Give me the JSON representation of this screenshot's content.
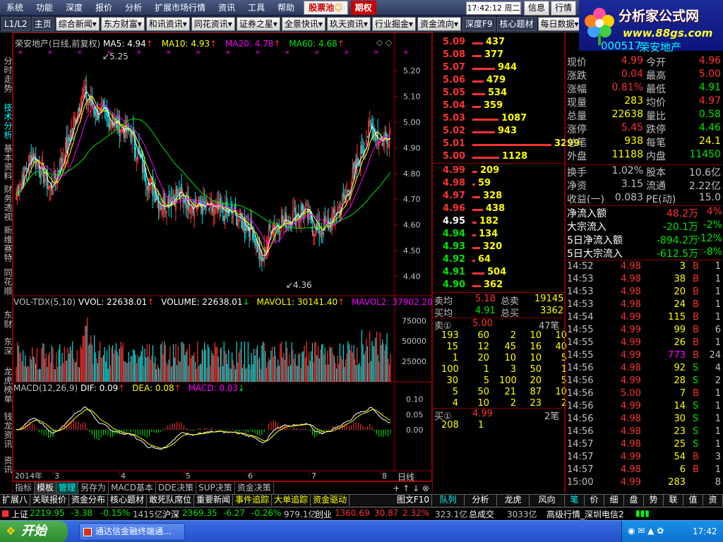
{
  "menu": {
    "items": [
      "系统",
      "功能",
      "深度",
      "报价",
      "分析",
      "扩展市场行情",
      "资讯",
      "工具",
      "帮助"
    ],
    "stock_pool": "股票池",
    "options": "期权",
    "clock": "17:42:12 周二",
    "msg": "信息",
    "quote": "行情"
  },
  "toolbar": {
    "items": [
      "L1/L2",
      "主页",
      "综合新闻▾",
      "东方财富▾",
      "和讯资讯▾",
      "同花资讯▾",
      "证券之星▾",
      "全景快讯▾",
      "玖天资讯▾",
      "行业掘金▾",
      "资金流向▾",
      "深度F9",
      "核心题材",
      "每日数据▾"
    ]
  },
  "logo": {
    "title": "分析家公式网",
    "url": "www.88gs.com"
  },
  "vtabs": [
    "分时走势",
    "技术分析",
    "基本资料",
    "财务透视",
    "新维赛特",
    "同花顺",
    "东财",
    "东深",
    "龙虎榜单",
    "钱龙资讯",
    "资讯"
  ],
  "chart": {
    "title": "荣安地产(日线,前复权)",
    "ma5": "MA5: 4.94",
    "ma10": "MA10: 4.93",
    "ma20": "MA20: 4.78",
    "ma60": "MA60: 4.68",
    "price_ticks": [
      "5.20",
      "5.10",
      "5.00",
      "4.90",
      "4.80",
      "4.70",
      "4.60",
      "4.50",
      "4.40"
    ],
    "high_label": "5.25",
    "low_label": "4.36",
    "vol_title": "VOL-TDX(5,10)",
    "vvol": "VVOL: 22638.01",
    "volume": "VOLUME: 22638.01",
    "mavol1": "MAVOL1: 30141.40",
    "mavol2": "MAVOL2: 37902.20",
    "vol_ticks": [
      "75000",
      "50000",
      "25000"
    ],
    "macd_title": "MACD(12,26,9)",
    "dif": "DIF: 0.09",
    "dea": "DEA: 0.08",
    "macd": "MACD: 0.03",
    "macd_ticks": [
      "0.10",
      "0.05",
      "0.00"
    ],
    "x_labels": [
      "2014年",
      "3",
      "4",
      "5",
      "6",
      "7",
      "8"
    ],
    "period": "日线"
  },
  "chart_tabs": [
    "指标",
    "模板",
    "管理",
    "另存为",
    "MACD基本",
    "DDE决策",
    "SUP决策",
    "资金决策"
  ],
  "bottom_tabs": [
    "扩展八",
    "关联报价",
    "资金分布",
    "核心题材",
    "敢死队席位",
    "重要新闻",
    "事件追踪",
    "大单追踪",
    "资金驱动",
    "图文F10"
  ],
  "book": {
    "asks": [
      [
        "5.09",
        "437"
      ],
      [
        "5.08",
        "377"
      ],
      [
        "5.07",
        "944"
      ],
      [
        "5.06",
        "479"
      ],
      [
        "5.05",
        "534"
      ],
      [
        "5.04",
        "359"
      ],
      [
        "5.03",
        "1087"
      ],
      [
        "5.02",
        "943"
      ],
      [
        "5.01",
        "3299"
      ],
      [
        "5.00",
        "1128"
      ]
    ],
    "bids": [
      [
        "4.99",
        "209"
      ],
      [
        "4.98",
        "59"
      ],
      [
        "4.97",
        "328"
      ],
      [
        "4.96",
        "438"
      ],
      [
        "4.95",
        "182"
      ],
      [
        "4.94",
        "134"
      ],
      [
        "4.93",
        "320"
      ],
      [
        "4.92",
        "64"
      ],
      [
        "4.91",
        "504"
      ],
      [
        "4.90",
        "362"
      ]
    ],
    "ask_avg_label": "卖均",
    "ask_avg": "5.18",
    "ask_total_label": "总卖",
    "ask_total": "19145",
    "bid_avg_label": "买均",
    "bid_avg": "4.91",
    "bid_total_label": "总买",
    "bid_total": "3362",
    "sell1": "卖①",
    "sell1_px": "5.00",
    "sell1_cnt": "47笔",
    "sell_queue": [
      [
        "193",
        "60",
        "2",
        "10",
        "10"
      ],
      [
        "15",
        "12",
        "45",
        "16",
        "40"
      ],
      [
        "1",
        "20",
        "10",
        "10",
        "5"
      ],
      [
        "100",
        "1",
        "3",
        "50",
        "1"
      ],
      [
        "30",
        "5",
        "100",
        "20",
        "5"
      ],
      [
        "5",
        "50",
        "21",
        "87",
        "10"
      ],
      [
        "4",
        "10",
        "2",
        "23",
        "2"
      ]
    ],
    "buy1": "买①",
    "buy1_px": "4.99",
    "buy1_cnt": "2笔",
    "buy_queue": [
      "208",
      "1"
    ]
  },
  "info": {
    "code": "000517",
    "name": "荣安地产",
    "rows": [
      [
        "现价",
        "4.99",
        "今开",
        "4.96"
      ],
      [
        "涨跌",
        "0.04",
        "最高",
        "5.00"
      ],
      [
        "涨幅",
        "0.81%",
        "最低",
        "4.91"
      ],
      [
        "现量",
        "283",
        "均价",
        "4.97"
      ],
      [
        "总量",
        "22638",
        "量比",
        "0.58"
      ],
      [
        "涨停",
        "5.45",
        "跌停",
        "4.46"
      ],
      [
        "总笔",
        "938",
        "每笔",
        "24.1"
      ],
      [
        "外盘",
        "11188",
        "内盘",
        "11450"
      ]
    ],
    "rows2": [
      [
        "换手",
        "1.02%",
        "股本",
        "10.6亿"
      ],
      [
        "净资",
        "3.15",
        "流通",
        "2.22亿"
      ],
      [
        "收益(一)",
        "0.083",
        "PE(动)",
        "15.0"
      ]
    ],
    "flows": [
      [
        "净流入额",
        "48.2万",
        "4%"
      ],
      [
        "大宗流入",
        "-20.1万",
        "-2%"
      ],
      [
        "5日净流入额",
        "-894.2万",
        "-12%"
      ],
      [
        "5日大宗流入",
        "-612.5万",
        "-8%"
      ]
    ],
    "ticks": [
      [
        "14:52",
        "4.98",
        "3",
        "B",
        "1"
      ],
      [
        "14:53",
        "4.98",
        "38",
        "B",
        "1"
      ],
      [
        "14:53",
        "4.98",
        "20",
        "B",
        "1"
      ],
      [
        "14:53",
        "4.98",
        "24",
        "B",
        "1"
      ],
      [
        "14:54",
        "4.99",
        "115",
        "B",
        "1"
      ],
      [
        "14:55",
        "4.99",
        "99",
        "B",
        "6"
      ],
      [
        "14:55",
        "4.99",
        "26",
        "B",
        "1"
      ],
      [
        "14:55",
        "4.99",
        "773",
        "B",
        "24"
      ],
      [
        "14:56",
        "4.98",
        "92",
        "S",
        "4"
      ],
      [
        "14:56",
        "4.99",
        "28",
        "S",
        "2"
      ],
      [
        "14:56",
        "5.00",
        "7",
        "B",
        "1"
      ],
      [
        "14:56",
        "4.99",
        "14",
        "S",
        "1"
      ],
      [
        "14:56",
        "4.98",
        "30",
        "S",
        "1"
      ],
      [
        "14:56",
        "4.98",
        "23",
        "S",
        "1"
      ],
      [
        "14:57",
        "4.98",
        "25",
        "S",
        "1"
      ],
      [
        "14:57",
        "4.99",
        "54",
        "B",
        "3"
      ],
      [
        "14:57",
        "4.98",
        "6",
        "B",
        "1"
      ],
      [
        "15:00",
        "4.99",
        "283",
        "",
        "8"
      ]
    ]
  },
  "right_tabs_mid": [
    "队列",
    "分析",
    "龙虎",
    "风向"
  ],
  "right_tabs": [
    "笔",
    "价",
    "细",
    "盘",
    "势",
    "联",
    "值",
    "资"
  ],
  "index": {
    "sh_label": "上证",
    "sh": "2219.95",
    "sh_chg": "-3.38",
    "sh_pct": "-0.15%",
    "sh_amt": "1415亿",
    "hs_label": "沪深",
    "hs": "2369.35",
    "hs_chg": "-6.27",
    "hs_pct": "-0.26%",
    "hs_amt": "979.1亿",
    "cy_label": "创业",
    "cy": "1360.69",
    "cy_chg": "30.87",
    "cy_pct": "2.32%",
    "cy_amt": "323.1亿",
    "total_label": "总成交",
    "total": "3033亿",
    "server": "高级行情_深圳电信2"
  },
  "taskbar": {
    "start": "开始",
    "task": "通达信金融终端通...",
    "time": "17:42"
  }
}
